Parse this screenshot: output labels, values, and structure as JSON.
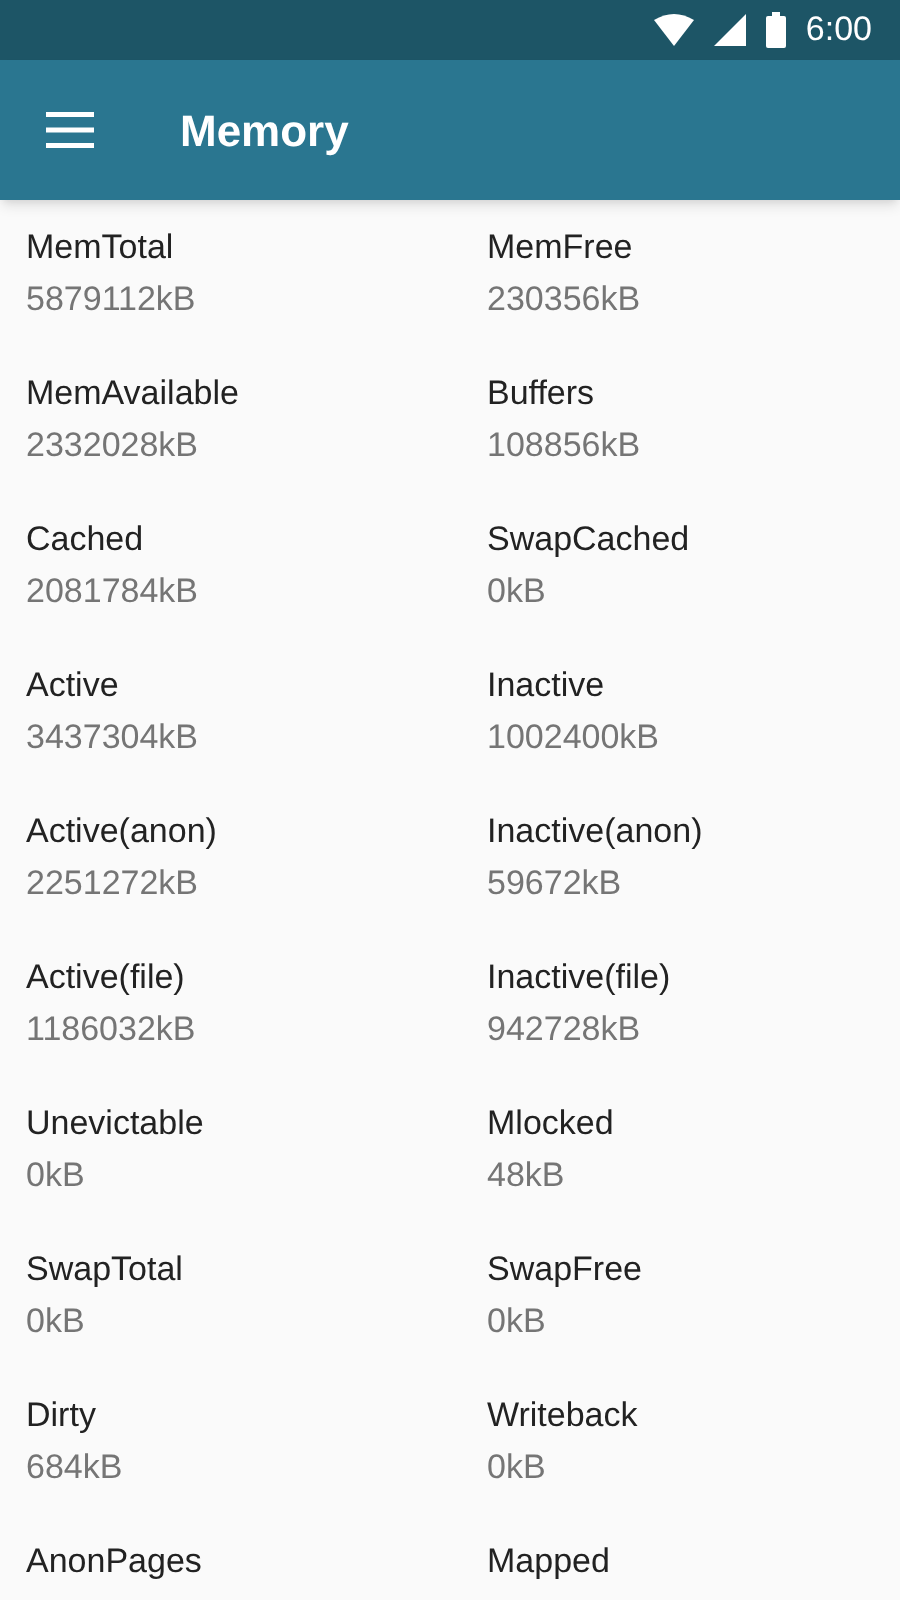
{
  "status_bar": {
    "time": "6:00"
  },
  "toolbar": {
    "title": "Memory"
  },
  "entries": [
    {
      "name": "MemTotal",
      "value": "5879112kB"
    },
    {
      "name": "MemFree",
      "value": "230356kB"
    },
    {
      "name": "MemAvailable",
      "value": "2332028kB"
    },
    {
      "name": "Buffers",
      "value": "108856kB"
    },
    {
      "name": "Cached",
      "value": "2081784kB"
    },
    {
      "name": "SwapCached",
      "value": "0kB"
    },
    {
      "name": "Active",
      "value": "3437304kB"
    },
    {
      "name": "Inactive",
      "value": "1002400kB"
    },
    {
      "name": "Active(anon)",
      "value": "2251272kB"
    },
    {
      "name": "Inactive(anon)",
      "value": "59672kB"
    },
    {
      "name": "Active(file)",
      "value": "1186032kB"
    },
    {
      "name": "Inactive(file)",
      "value": "942728kB"
    },
    {
      "name": "Unevictable",
      "value": "0kB"
    },
    {
      "name": "Mlocked",
      "value": "48kB"
    },
    {
      "name": "SwapTotal",
      "value": "0kB"
    },
    {
      "name": "SwapFree",
      "value": "0kB"
    },
    {
      "name": "Dirty",
      "value": "684kB"
    },
    {
      "name": "Writeback",
      "value": "0kB"
    },
    {
      "name": "AnonPages"
    },
    {
      "name": "Mapped"
    }
  ]
}
